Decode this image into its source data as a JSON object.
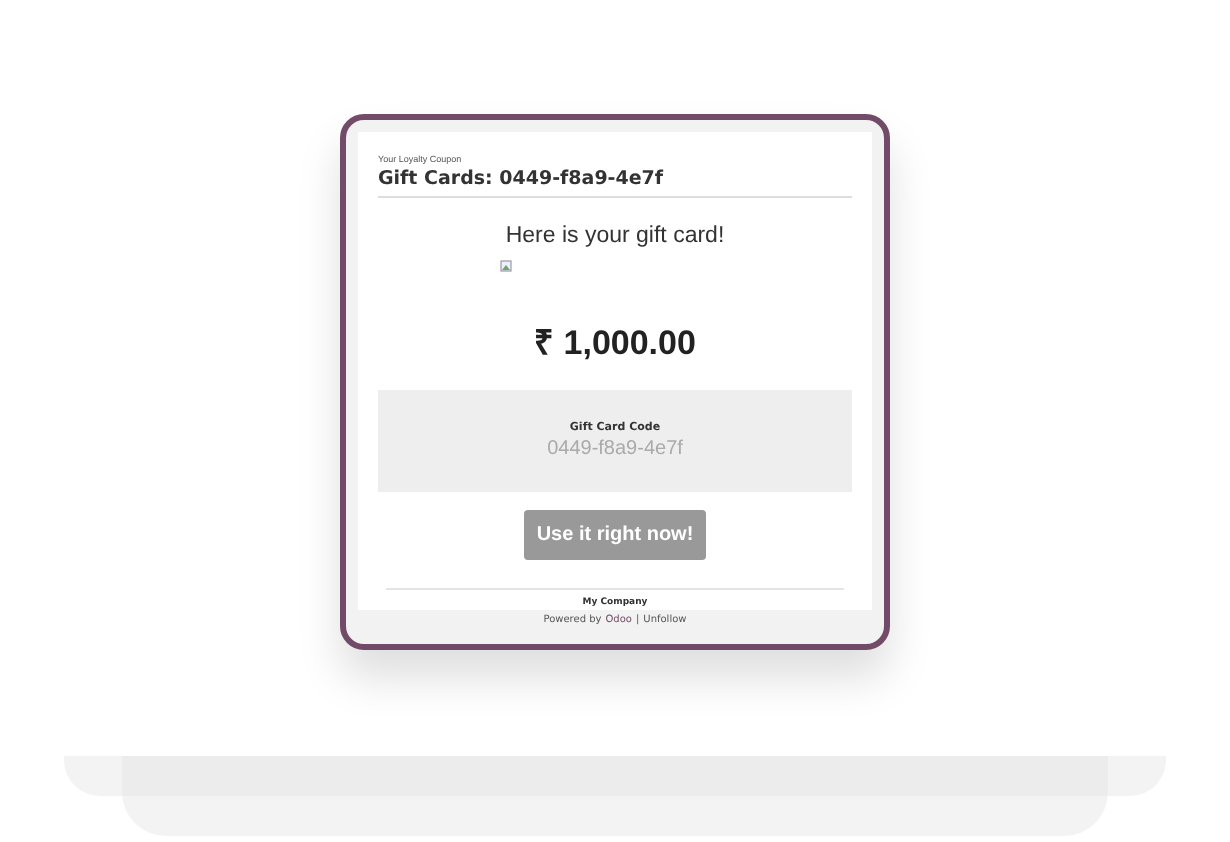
{
  "email": {
    "subtitle": "Your Loyalty Coupon",
    "title": "Gift Cards: 0449-f8a9-4e7f",
    "greeting": "Here is your gift card!",
    "amount": "₹ 1,000.00",
    "code_label": "Gift Card Code",
    "code": "0449-f8a9-4e7f",
    "button": "Use it right now!",
    "company": "My Company"
  },
  "footer": {
    "powered_by": "Powered by",
    "link": "Odoo",
    "separator": "|",
    "unfollow": "Unfollow"
  }
}
